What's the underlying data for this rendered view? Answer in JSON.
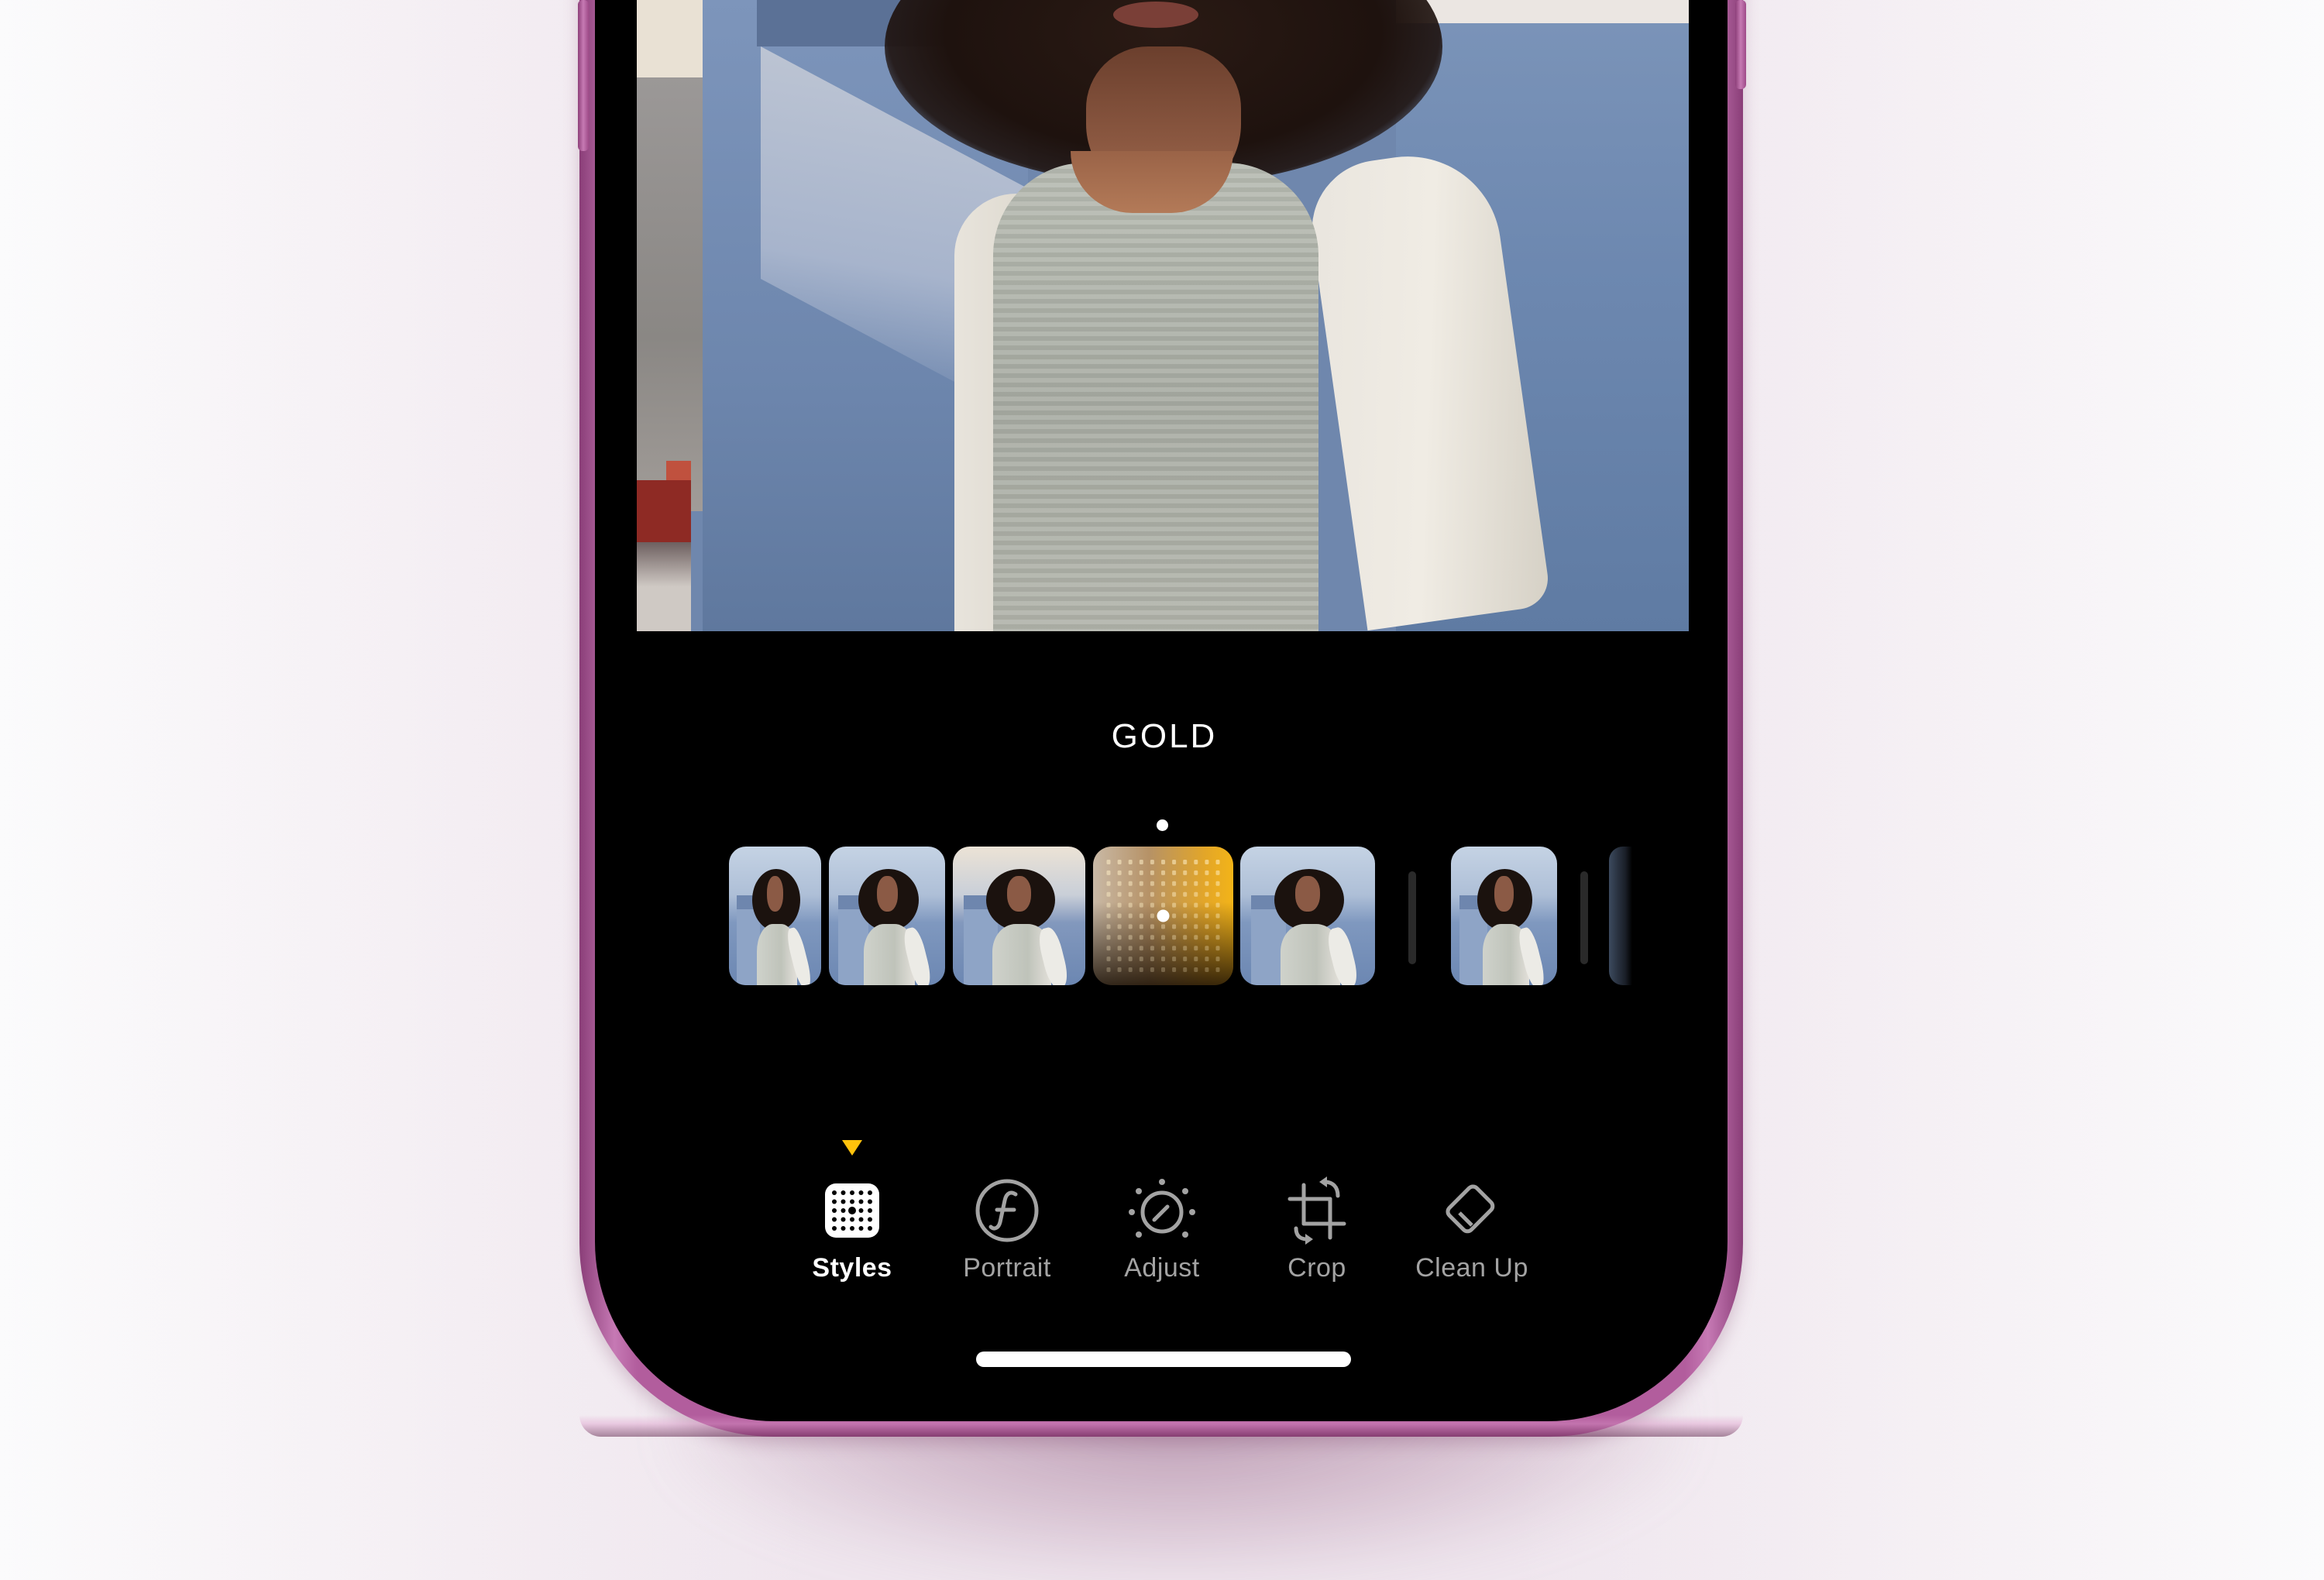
{
  "app": {
    "name": "Photos Editor",
    "device_color": "#b25d9d"
  },
  "photo": {
    "style_name_overlay": "GOLD",
    "description": "portrait-photo"
  },
  "style_strip": {
    "selected_index": 3,
    "selected_style": "Gold",
    "items": [
      {
        "kind": "thumbnail",
        "tone": "cool"
      },
      {
        "kind": "thumbnail",
        "tone": "neutral"
      },
      {
        "kind": "thumbnail",
        "tone": "warm"
      },
      {
        "kind": "style-pad",
        "accent": "#f3b418"
      },
      {
        "kind": "thumbnail",
        "tone": "neutral"
      },
      {
        "kind": "divider"
      },
      {
        "kind": "thumbnail",
        "tone": "neutral"
      },
      {
        "kind": "divider"
      },
      {
        "kind": "thumbnail",
        "tone": "dark-partial"
      }
    ],
    "pad_grid": {
      "rows": 11,
      "cols": 11,
      "handle_x": 0.5,
      "handle_y": 0.5
    }
  },
  "toolbar": {
    "active_index": 0,
    "active_color": "#ffc20c",
    "tools": [
      {
        "label": "Styles",
        "icon": "styles-grid-icon"
      },
      {
        "label": "Portrait",
        "icon": "portrait-f-icon"
      },
      {
        "label": "Adjust",
        "icon": "adjust-dial-icon"
      },
      {
        "label": "Crop",
        "icon": "crop-rotate-icon"
      },
      {
        "label": "Clean Up",
        "icon": "eraser-icon"
      }
    ]
  }
}
